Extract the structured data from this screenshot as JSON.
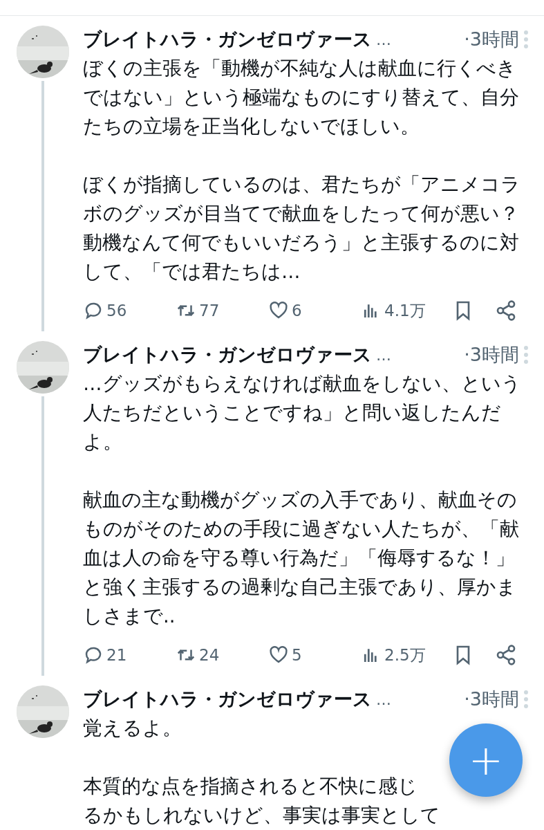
{
  "tweets": [
    {
      "author": "ブレイトハラ・ガンゼロヴァース",
      "ellipsis": "…",
      "time": "·3時間",
      "paragraphs": [
        "ぼくの主張を「動機が不純な人は献血に行くべきではない」という極端なものにすり替えて、自分たちの立場を正当化しないでほしい。",
        "ぼくが指摘しているのは、君たちが「アニメコラボのグッズが目当てで献血をしたって何が悪い？動機なんて何でもいいだろう」と主張するのに対して、「では君たちは…"
      ],
      "stats": {
        "replies": "56",
        "reposts": "77",
        "likes": "6",
        "views": "4.1万"
      },
      "thread_line": true
    },
    {
      "author": "ブレイトハラ・ガンゼロヴァース",
      "ellipsis": "…",
      "time": "·3時間",
      "paragraphs": [
        "…グッズがもらえなければ献血をしない、という人たちだということですね」と問い返したんだよ。",
        "献血の主な動機がグッズの入手であり、献血そのものがそのための手段に過ぎない人たちが、「献血は人の命を守る尊い行為だ」「侮辱するな！」と強く主張するの過剰な自己主張であり、厚かましさまで.."
      ],
      "stats": {
        "replies": "21",
        "reposts": "24",
        "likes": "5",
        "views": "2.5万"
      },
      "thread_line": true
    },
    {
      "author": "ブレイトハラ・ガンゼロヴァース",
      "ellipsis": "…",
      "time": "·3時間",
      "paragraphs": [
        "覚えるよ。",
        [
          "本質的な点を指摘されると不快に感じ",
          "るかもしれないけど、事実は事実として"
        ]
      ],
      "thread_line": false
    }
  ],
  "fab": {
    "label": "+"
  }
}
